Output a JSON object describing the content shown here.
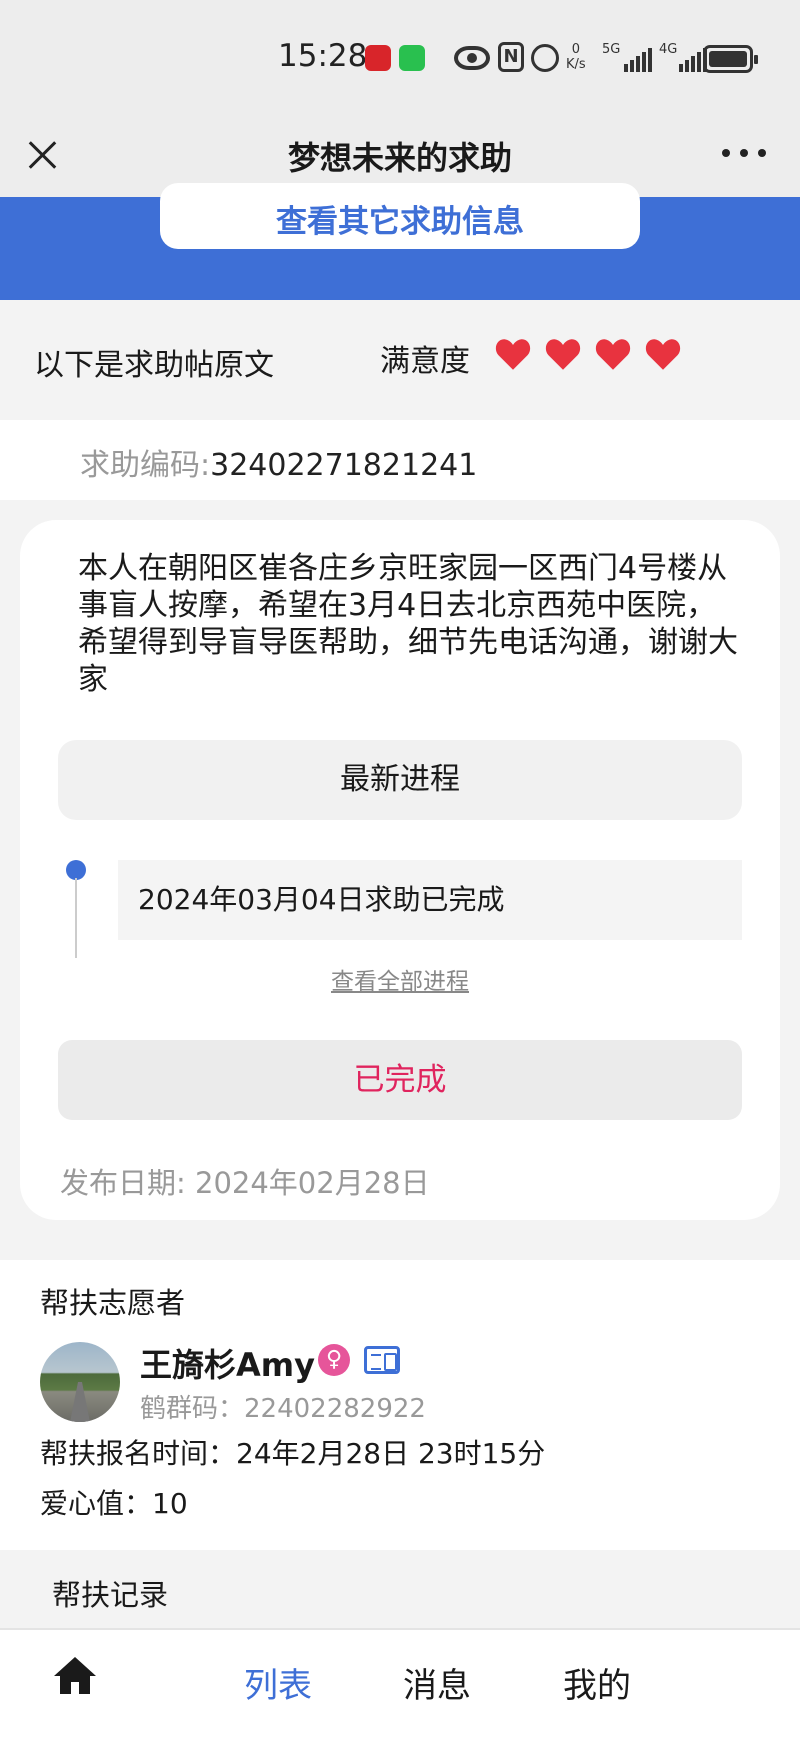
{
  "status_bar": {
    "time": "15:28",
    "net_speed_top": "0",
    "net_speed_unit": "K/s",
    "signal1_label": "5G",
    "signal2_label": "4G",
    "icons": [
      "app-red-icon",
      "wechat-icon",
      "eye-icon",
      "nfc-icon",
      "alarm-icon",
      "signal-icon",
      "battery-icon"
    ]
  },
  "nav": {
    "title": "梦想未来的求助",
    "close_icon": "close-icon",
    "more_icon": "more-icon"
  },
  "banner": {
    "button_label": "查看其它求助信息",
    "color": "#3e6fd6"
  },
  "rating": {
    "intro": "以下是求助帖原文",
    "label": "满意度",
    "hearts": 4,
    "heart_color": "#e8333f"
  },
  "request": {
    "code_label": "求助编码:",
    "code_value": "32402271821241",
    "text": "本人在朝阳区崔各庄乡京旺家园一区西门4号楼从事盲人按摩，希望在3月4日去北京西苑中医院，希望得到导盲导医帮助，细节先电话沟通，谢谢大家",
    "progress_header": "最新进程",
    "progress_items": [
      "2024年03月04日求助已完成"
    ],
    "view_all": "查看全部进程",
    "status_button": "已完成",
    "status_color": "#e0245e",
    "publish_date": "发布日期: 2024年02月28日"
  },
  "volunteer": {
    "section_title": "帮扶志愿者",
    "name": "王旖杉Amy",
    "gender_icon": "female-icon",
    "id_icon": "id-card-icon",
    "code": "鹤群码：22402282922",
    "signup_time": "帮扶报名时间：24年2月28日 23时15分",
    "love_value": "爱心值：10"
  },
  "record": {
    "title": "帮扶记录"
  },
  "tabbar": {
    "home_icon": "home-icon",
    "tabs": [
      "列表",
      "消息",
      "我的"
    ],
    "active_index": 0,
    "active_color": "#3e6fd6"
  }
}
